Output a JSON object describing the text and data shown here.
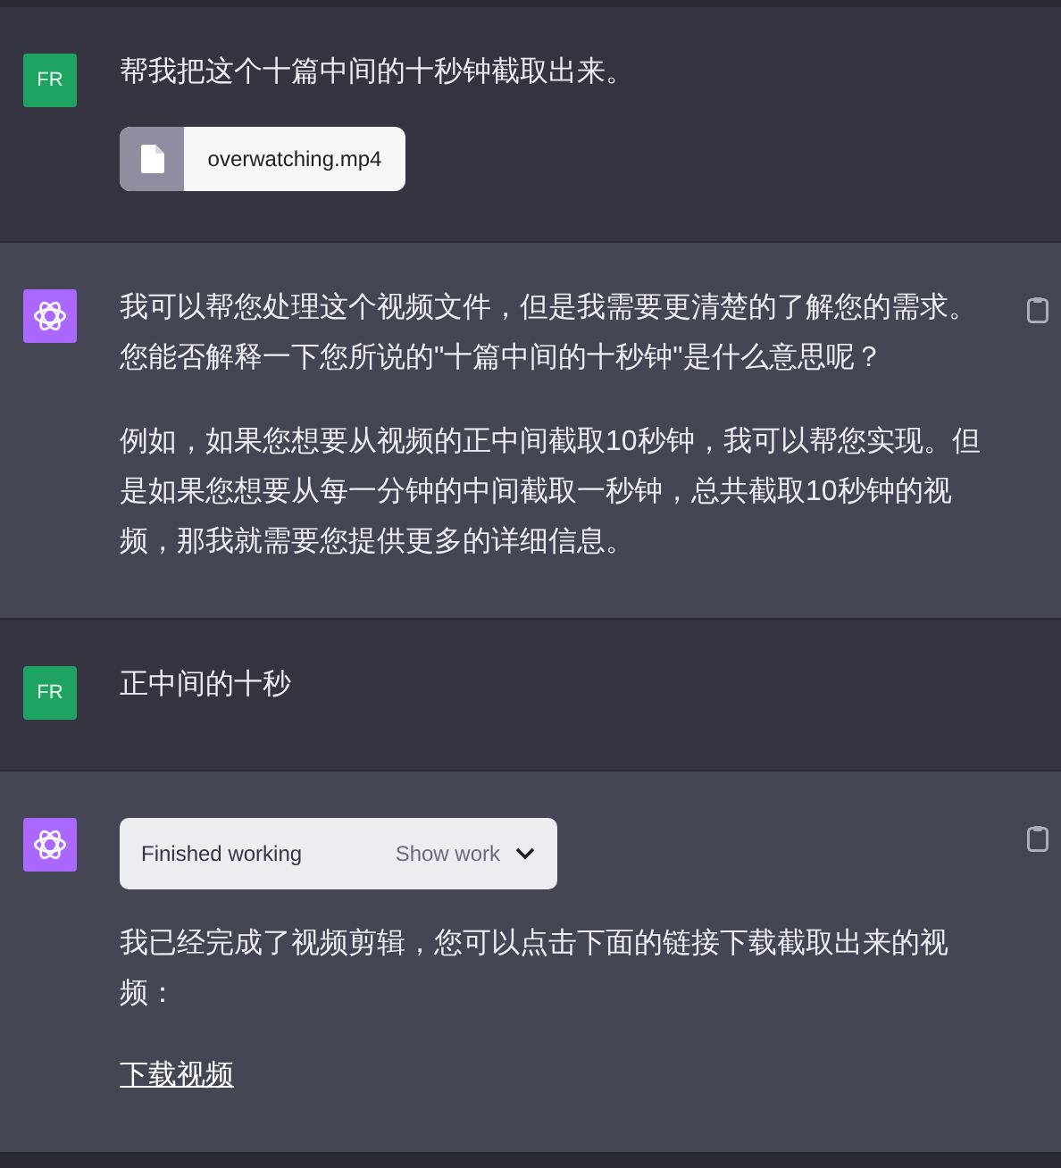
{
  "messages": [
    {
      "kind": "user",
      "avatar": "FR",
      "blocks": [
        {
          "kind": "paragraph",
          "text": "帮我把这个十篇中间的十秒钟截取出来。"
        },
        {
          "kind": "file",
          "name": "overwatching.mp4"
        }
      ]
    },
    {
      "kind": "assistant",
      "blocks": [
        {
          "kind": "paragraph",
          "text": "我可以帮您处理这个视频文件，但是我需要更清楚的了解您的需求。您能否解释一下您所说的\"十篇中间的十秒钟\"是什么意思呢？"
        },
        {
          "kind": "paragraph",
          "text": "例如，如果您想要从视频的正中间截取10秒钟，我可以帮您实现。但是如果您想要从每一分钟的中间截取一秒钟，总共截取10秒钟的视频，那我就需要您提供更多的详细信息。"
        }
      ]
    },
    {
      "kind": "user",
      "avatar": "FR",
      "blocks": [
        {
          "kind": "paragraph",
          "text": "正中间的十秒"
        }
      ]
    },
    {
      "kind": "assistant",
      "blocks": [
        {
          "kind": "work",
          "status": "Finished working",
          "action": "Show work"
        },
        {
          "kind": "paragraph",
          "text": "我已经完成了视频剪辑，您可以点击下面的链接下载截取出来的视频："
        },
        {
          "kind": "link",
          "text": "下载视频"
        }
      ]
    }
  ]
}
